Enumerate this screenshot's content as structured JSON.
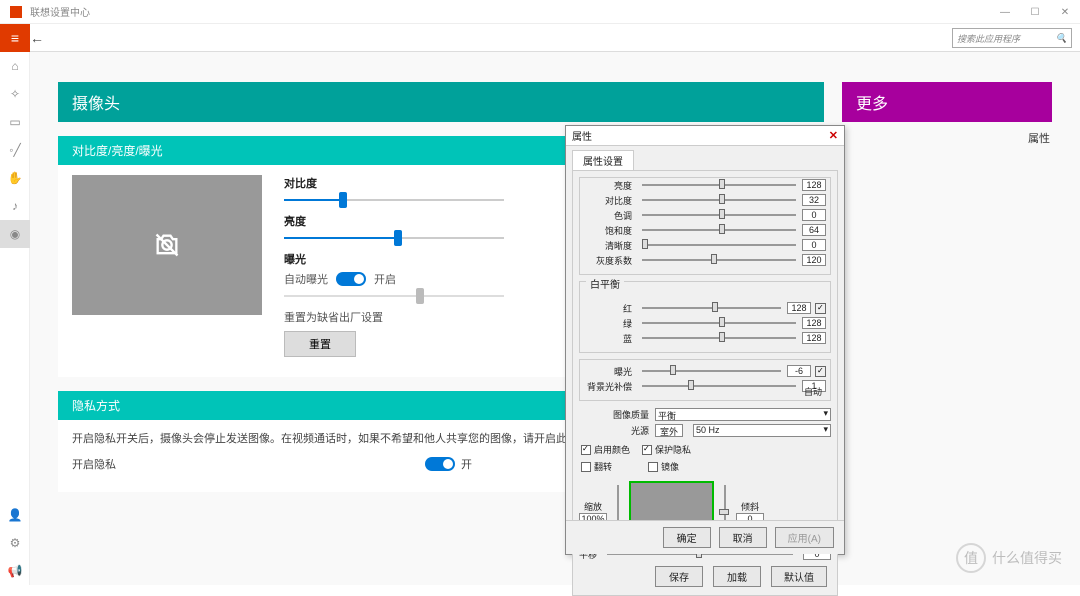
{
  "app": {
    "title": "联想设置中心"
  },
  "search": {
    "placeholder": "搜索此应用程序"
  },
  "headers": {
    "camera": "摄像头",
    "more": "更多",
    "side_item": "属性"
  },
  "panel1": {
    "title": "对比度/亮度/曝光",
    "contrast": "对比度",
    "brightness": "亮度",
    "exposure": "曝光",
    "auto_exposure": "自动曝光",
    "on": "开启",
    "reset_text": "重置为缺省出厂设置",
    "reset_btn": "重置"
  },
  "panel2": {
    "title": "隐私方式",
    "desc": "开启隐私开关后，摄像头会停止发送图像。在视频通话时，如果不希望和他人共享您的图像，请开启此开关。",
    "enable": "开启隐私",
    "on": "开"
  },
  "modal": {
    "title": "属性",
    "tab": "属性设置",
    "rows": {
      "brightness": {
        "label": "亮度",
        "val": "128"
      },
      "contrast": {
        "label": "对比度",
        "val": "32"
      },
      "hue": {
        "label": "色调",
        "val": "0"
      },
      "saturation": {
        "label": "饱和度",
        "val": "64"
      },
      "sharpness": {
        "label": "清晰度",
        "val": "0"
      },
      "gamma": {
        "label": "灰度系数",
        "val": "120"
      }
    },
    "wb": {
      "label": "白平衡",
      "red": "红",
      "green": "绿",
      "blue": "蓝",
      "rv": "128",
      "gv": "128",
      "bv": "128"
    },
    "exp": {
      "label": "曝光",
      "val": "-6",
      "backlight": "背景光补偿",
      "bv": "1",
      "auto": "自动"
    },
    "imgq": {
      "label": "图像质量",
      "sel": "平衡"
    },
    "light": {
      "label": "光源",
      "sel": "室外",
      "hz": "50 Hz"
    },
    "cb": {
      "color_enable": "启用颜色",
      "protect_privacy": "保护隐私",
      "flip": "翻转",
      "mirror": "镜像"
    },
    "zoom": {
      "label": "缩放",
      "val": "100%",
      "tilt": "倾斜",
      "tiltv": "0",
      "pan": "平移",
      "panv": "0"
    },
    "btns": {
      "save": "保存",
      "load": "加载",
      "default": "默认值",
      "ok": "确定",
      "cancel": "取消",
      "apply": "应用(A)"
    }
  },
  "watermark": {
    "char": "值",
    "text": "什么值得买"
  }
}
